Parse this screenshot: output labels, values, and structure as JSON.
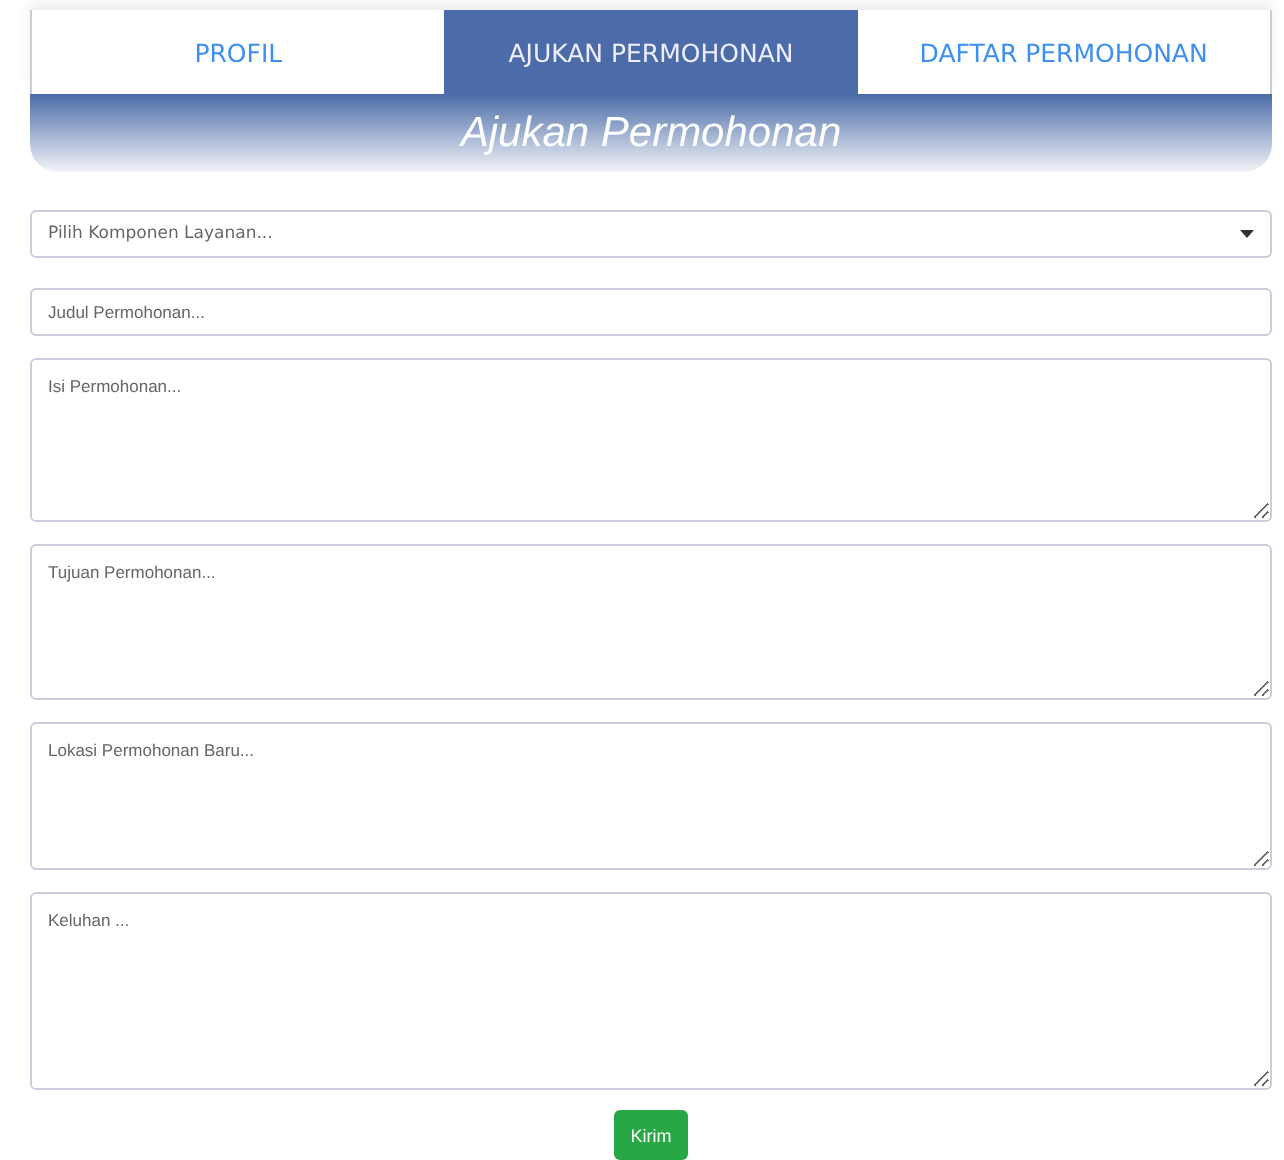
{
  "tabs": [
    {
      "label": "PROFIL",
      "selected": false
    },
    {
      "label": "AJUKAN PERMOHONAN",
      "selected": true
    },
    {
      "label": "DAFTAR PERMOHONAN",
      "selected": false
    }
  ],
  "banner": {
    "title": "Ajukan Permohonan"
  },
  "fields": [
    {
      "kind": "select",
      "placeholder": "Pilih Komponen Layanan..."
    },
    {
      "kind": "input",
      "placeholder": "Judul Permohonan..."
    },
    {
      "kind": "textarea",
      "placeholder": "Isi Permohonan..."
    },
    {
      "kind": "textarea",
      "placeholder": "Tujuan Permohonan..."
    },
    {
      "kind": "textarea",
      "placeholder": "Lokasi Permohonan Baru..."
    },
    {
      "kind": "textarea",
      "placeholder": "Keluhan ..."
    }
  ],
  "submit": {
    "label": "Kirim"
  }
}
